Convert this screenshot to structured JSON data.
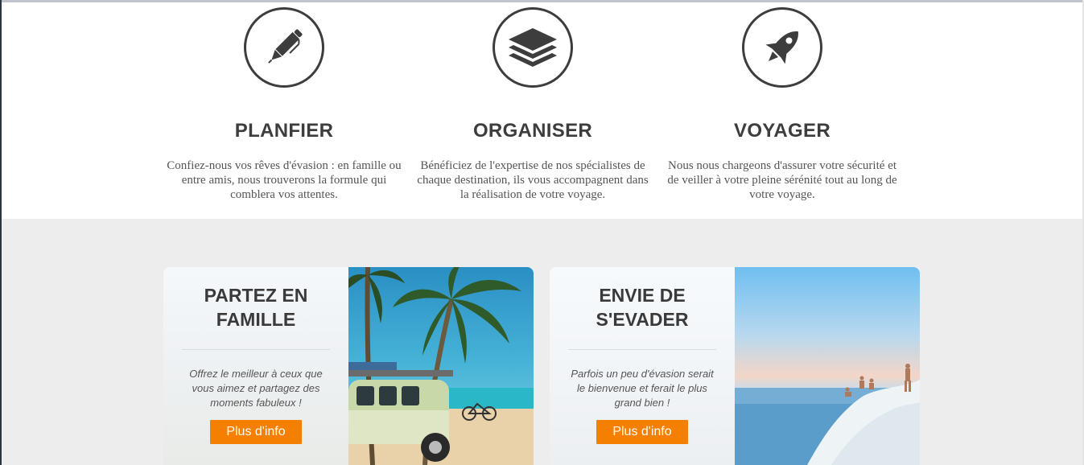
{
  "features": [
    {
      "title": "PLANFIER",
      "icon": "pen-icon",
      "text": "Confiez-nous vos rêves d'évasion : en famille ou entre amis, nous trouverons la formule qui comblera vos attentes."
    },
    {
      "title": "ORGANISER",
      "icon": "layers-icon",
      "text": "Bénéficiez de l'expertise de nos spécialistes de chaque destination, ils vous accompagnent dans la réalisation de votre voyage."
    },
    {
      "title": "VOYAGER",
      "icon": "rocket-icon",
      "text": "Nous nous chargeons d'assurer votre sécurité et de veiller à votre pleine sérénité tout au long de votre voyage."
    }
  ],
  "cards": [
    {
      "title_line1": "PARTEZ EN",
      "title_line2": "FAMILLE",
      "description": "Offrez le meilleur à ceux que vous aimez et partagez des moments fabuleux !",
      "button_label": "Plus d'info",
      "image": "beach-van-photo"
    },
    {
      "title_line1": "ENVIE DE",
      "title_line2": "S'EVADER",
      "description": "Parfois un peu d'évasion serait le bienvenue et ferait le plus grand bien !",
      "button_label": "Plus d'info",
      "image": "sea-cliff-photo"
    }
  ],
  "colors": {
    "accent": "#f57f00",
    "text_dark": "#3d3d3d",
    "section_gray": "#ededed"
  }
}
